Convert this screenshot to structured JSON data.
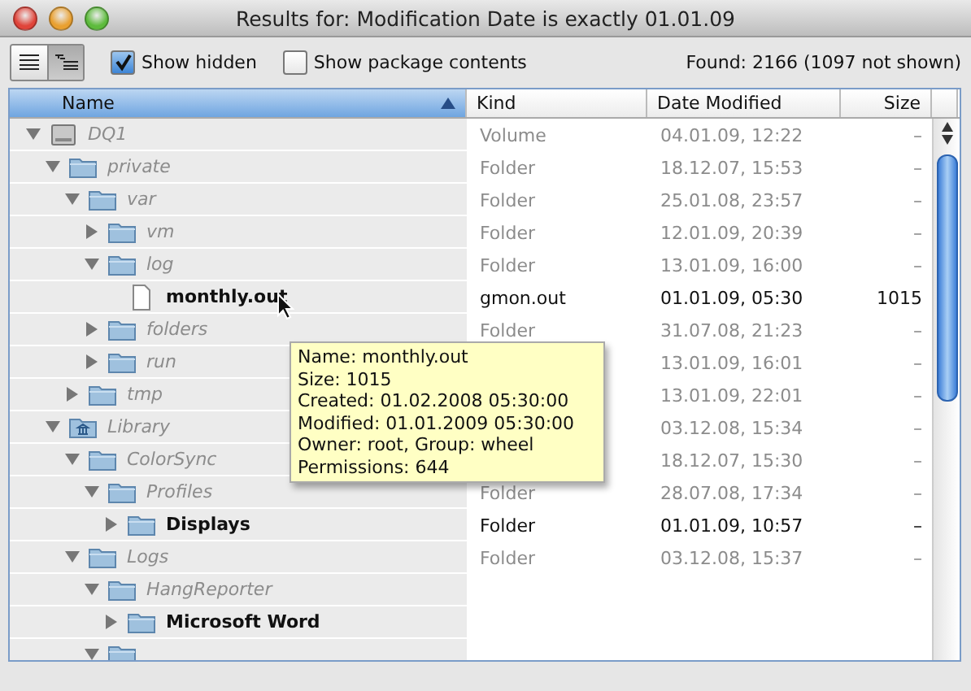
{
  "window": {
    "title": "Results for: Modification Date is exactly 01.01.09"
  },
  "toolbar": {
    "view_buttons": [
      {
        "kind": "list",
        "selected": false
      },
      {
        "kind": "outline",
        "selected": true
      }
    ],
    "checkboxes": [
      {
        "label": "Show hidden",
        "checked": true
      },
      {
        "label": "Show package contents",
        "checked": false
      }
    ],
    "found": "Found: 2166 (1097 not shown)"
  },
  "table": {
    "columns": [
      {
        "label": "Name",
        "selected": true
      },
      {
        "label": "Kind",
        "selected": false
      },
      {
        "label": "Date Modified",
        "selected": false
      },
      {
        "label": "Size",
        "selected": false
      }
    ],
    "rows": [
      {
        "name": "DQ1",
        "kind": "volume",
        "matched": false,
        "expanded": true,
        "kind_label": "Volume",
        "date_modified": "04.01.09, 12:22",
        "size": "–",
        "children": [
          {
            "name": "private",
            "kind": "folder",
            "matched": false,
            "expanded": true,
            "kind_label": "Folder",
            "date_modified": "18.12.07, 15:53",
            "size": "–",
            "children": [
              {
                "name": "var",
                "kind": "folder",
                "matched": false,
                "expanded": true,
                "kind_label": "Folder",
                "date_modified": "25.01.08, 23:57",
                "size": "–",
                "children": [
                  {
                    "name": "vm",
                    "kind": "folder",
                    "matched": false,
                    "expanded": false,
                    "kind_label": "Folder",
                    "date_modified": "12.01.09, 20:39",
                    "size": "–"
                  },
                  {
                    "name": "log",
                    "kind": "folder",
                    "matched": false,
                    "expanded": true,
                    "kind_label": "Folder",
                    "date_modified": "13.01.09, 16:00",
                    "size": "–",
                    "children": [
                      {
                        "name": "monthly.out",
                        "kind": "file",
                        "matched": true,
                        "kind_label": "gmon.out",
                        "date_modified": "01.01.09, 05:30",
                        "size": "1015"
                      }
                    ]
                  },
                  {
                    "name": "folders",
                    "kind": "folder",
                    "matched": false,
                    "expanded": false,
                    "kind_label": "Folder",
                    "date_modified": "31.07.08, 21:23",
                    "size": "–"
                  },
                  {
                    "name": "run",
                    "kind": "folder",
                    "matched": false,
                    "expanded": false,
                    "date_modified": "13.01.09, 16:01",
                    "size": "–"
                  }
                ]
              },
              {
                "name": "tmp",
                "kind": "folder",
                "matched": false,
                "expanded": false,
                "date_modified": "13.01.09, 22:01",
                "size": "–"
              }
            ]
          },
          {
            "name": "Library",
            "kind": "library",
            "matched": false,
            "expanded": true,
            "date_modified": "03.12.08, 15:34",
            "size": "–",
            "children": [
              {
                "name": "ColorSync",
                "kind": "folder",
                "matched": false,
                "expanded": true,
                "date_modified": "18.12.07, 15:30",
                "size": "–",
                "children": [
                  {
                    "name": "Profiles",
                    "kind": "folder",
                    "matched": false,
                    "expanded": true,
                    "kind_label": "Folder",
                    "date_modified": "28.07.08, 17:34",
                    "size": "–",
                    "children": [
                      {
                        "name": "Displays",
                        "kind": "folder",
                        "matched": true,
                        "expanded": false,
                        "kind_label": "Folder",
                        "date_modified": "01.01.09, 10:57",
                        "size": "–"
                      }
                    ]
                  }
                ]
              },
              {
                "name": "Logs",
                "kind": "folder",
                "matched": false,
                "expanded": true,
                "kind_label": "Folder",
                "date_modified": "03.12.08, 15:37",
                "size": "–",
                "children": [
                  {
                    "name": "HangReporter",
                    "kind": "folder",
                    "matched": false,
                    "expanded": true,
                    "children": [
                      {
                        "name": "Microsoft Word",
                        "kind": "folder",
                        "matched": true,
                        "expanded": false
                      }
                    ]
                  },
                  {
                    "kind": "folder",
                    "expanded": true
                  }
                ]
              }
            ]
          }
        ]
      }
    ]
  },
  "tooltip": {
    "lines": [
      "Name: monthly.out",
      "Size: 1015",
      "Created: 01.02.2008 05:30:00",
      "Modified: 01.01.2009 05:30:00",
      "Owner: root, Group: wheel",
      "Permissions: 644"
    ]
  }
}
